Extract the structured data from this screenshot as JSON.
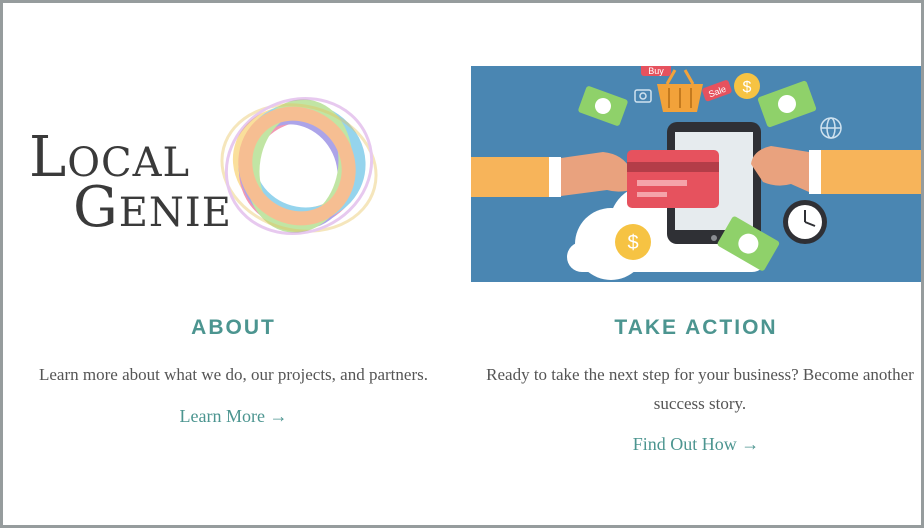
{
  "about": {
    "logo_line1_first": "L",
    "logo_line1_rest": "OCAL",
    "logo_line2_first": "G",
    "logo_line2_rest": "ENIE",
    "heading": "ABOUT",
    "description": "Learn more about what we do, our projects, and partners.",
    "link": "Learn More →"
  },
  "take_action": {
    "heading": "TAKE ACTION",
    "description": "Ready to take the next step for your business? Become another success story.",
    "link": "Find Out How →",
    "illustration_tags": [
      "Buy",
      "Sale"
    ],
    "currency_symbol": "$"
  },
  "colors": {
    "accent": "#4c9590",
    "text": "#555555",
    "hero_background": "#4a86b2",
    "frame": "#969c9d"
  }
}
